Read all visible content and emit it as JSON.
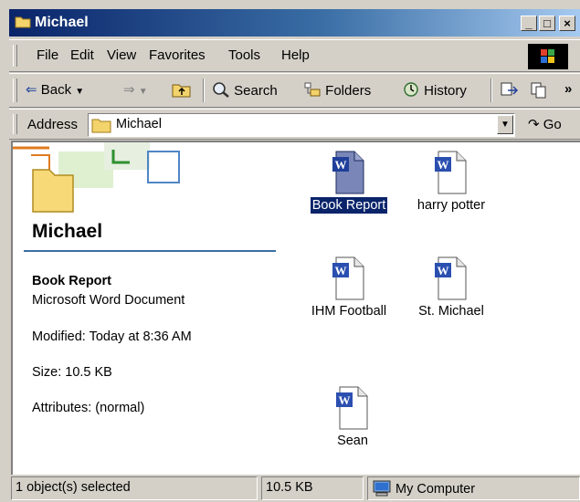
{
  "window": {
    "title": "Michael"
  },
  "title_buttons": {
    "minimize": "_",
    "maximize": "□",
    "close": "×"
  },
  "menu": [
    "File",
    "Edit",
    "View",
    "Favorites",
    "Tools",
    "Help"
  ],
  "toolbar": {
    "back": "Back",
    "search": "Search",
    "folders": "Folders",
    "history": "History",
    "overflow": "»"
  },
  "address": {
    "label": "Address",
    "value": "Michael",
    "go": "Go"
  },
  "sidebar": {
    "folder_name": "Michael",
    "selected_name": "Book Report",
    "selected_type": "Microsoft Word Document",
    "modified": "Modified: Today at 8:36 AM",
    "size": "Size: 10.5 KB",
    "attributes": "Attributes: (normal)"
  },
  "files": [
    {
      "name": "Book Report",
      "selected": true
    },
    {
      "name": "harry potter",
      "selected": false
    },
    {
      "name": "IHM Football",
      "selected": false
    },
    {
      "name": "St. Michael",
      "selected": false
    },
    {
      "name": "Sean",
      "selected": false
    }
  ],
  "status": {
    "selection": "1 object(s) selected",
    "size": "10.5 KB",
    "zone": "My Computer"
  },
  "colors": {
    "title_start": "#0a246a",
    "title_end": "#a6caf0",
    "word_blue": "#2b4fb0",
    "selection": "#0a246a"
  }
}
